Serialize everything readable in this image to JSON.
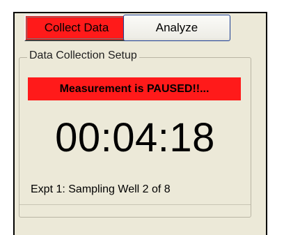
{
  "buttons": {
    "collect_label": "Collect Data",
    "analyze_label": "Analyze"
  },
  "group": {
    "title": "Data Collection Setup"
  },
  "status": {
    "banner": "Measurement is PAUSED!!...",
    "timer": "00:04:18",
    "line": "Expt 1: Sampling Well 2 of 8"
  },
  "colors": {
    "active_red": "#ff1a1a",
    "panel_bg": "#ece9d8",
    "xp_button_border": "#1c3f94"
  }
}
